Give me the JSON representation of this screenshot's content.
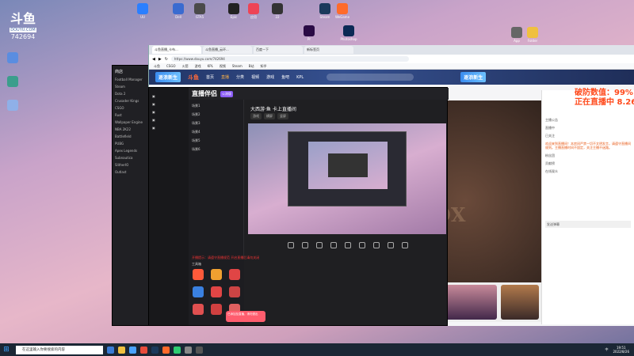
{
  "watermark": {
    "logo": "斗鱼",
    "sub": "DOUYU.COM",
    "room": "742694"
  },
  "desktop_icons": [
    {
      "label": "UU",
      "color": "#2b7fff"
    },
    {
      "label": "Dell",
      "color": "#3a6bd0"
    },
    {
      "label": "GTA5",
      "color": "#4a4a4a"
    },
    {
      "label": "Epic",
      "color": "#222"
    },
    {
      "label": "应用",
      "color": "#e45"
    },
    {
      "label": "22",
      "color": "#333"
    },
    {
      "label": "Steam",
      "color": "#1b3a5c"
    },
    {
      "label": "WeGame",
      "color": "#ff6b2b"
    },
    {
      "label": "Pr",
      "color": "#2a0b45"
    },
    {
      "label": "Photoshop",
      "color": "#0b2a55"
    },
    {
      "label": "App",
      "color": "#666"
    },
    {
      "label": "Folder",
      "color": "#f0c040"
    }
  ],
  "browser": {
    "tabs": [
      "斗鱼直播_卡布...",
      "斗鱼直播_云环...",
      "百度一下",
      "新标签页"
    ],
    "url": "https://www.douyu.com/742694",
    "bookmarks": [
      "斗鱼",
      "CSGO",
      "火箭",
      "游戏",
      "KPL",
      "视频",
      "Steam",
      "B站",
      "知乎"
    ],
    "nav": {
      "brand": "逐浪新生",
      "douyu": "斗鱼",
      "items": [
        "首页",
        "直播",
        "分类",
        "视频",
        "游戏",
        "鱼吧",
        "KPL"
      ],
      "right_brand": "逐浪新生"
    },
    "buttons": [
      "送礼物",
      "关注主播"
    ],
    "right_header": "PC端下载",
    "danmu": "破防数值：99%\n正在直播中 8.26日",
    "right_lines": [
      "主播公告",
      "直播中",
      "已关注",
      "欢迎来到直播间！本房间严禁一切不文明发言，请遵守直播间规则。主播直播时间不固定，关注主播不迷路。",
      "粉丝团",
      "贡献榜",
      "在线观众",
      "发送弹幕"
    ]
  },
  "obs": {
    "title": "直播伴侣",
    "badge": "公测版",
    "preview_title": "大西游·鱼 卡上直播间",
    "preview_tabs": [
      "游戏",
      "横屏",
      "竖屏"
    ],
    "scenes": [
      "场景1",
      "场景2",
      "场景3",
      "场景4",
      "场景5",
      "场景6"
    ],
    "tools_title": "工具箱",
    "status": "开播提示：请遵守直播规范 开启直播后请勿关闭"
  },
  "chat_window": {
    "title": "商店",
    "items": [
      "Football Manager",
      "Steam",
      "Dota 2",
      "Crusader Kings",
      "CSGO",
      "Rust",
      "Wallpaper Engine",
      "NBA 2K22",
      "Battlefield",
      "PUBG",
      "Apex Legends",
      "Subnautica",
      "SlitherIO",
      "Outlast"
    ]
  },
  "overlay": "已添加至直播，请勿退出",
  "taskbar": {
    "search": "在这里输入你要搜索的内容",
    "time": "19:51",
    "date": "2022/8/26",
    "tray_text": "中"
  }
}
